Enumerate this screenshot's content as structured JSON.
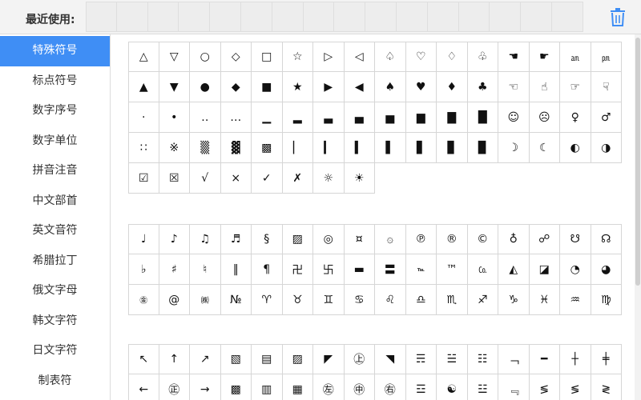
{
  "topbar": {
    "recent_label": "最近使用:",
    "recent_slot_count": 16
  },
  "sidebar": {
    "items": [
      {
        "label": "特殊符号",
        "active": true
      },
      {
        "label": "标点符号",
        "active": false
      },
      {
        "label": "数字序号",
        "active": false
      },
      {
        "label": "数字单位",
        "active": false
      },
      {
        "label": "拼音注音",
        "active": false
      },
      {
        "label": "中文部首",
        "active": false
      },
      {
        "label": "英文音符",
        "active": false
      },
      {
        "label": "希腊拉丁",
        "active": false
      },
      {
        "label": "俄文字母",
        "active": false
      },
      {
        "label": "韩文字符",
        "active": false
      },
      {
        "label": "日文字符",
        "active": false
      },
      {
        "label": "制表符",
        "active": false
      }
    ]
  },
  "groups": [
    {
      "rows": [
        [
          "△",
          "▽",
          "○",
          "◇",
          "□",
          "☆",
          "▷",
          "◁",
          "♤",
          "♡",
          "♢",
          "♧",
          "☚",
          "☛",
          "㏂",
          "㏘"
        ],
        [
          "▲",
          "▼",
          "●",
          "◆",
          "■",
          "★",
          "▶",
          "◀",
          "♠",
          "♥",
          "♦",
          "♣",
          "☜",
          "☝",
          "☞",
          "☟"
        ],
        [
          "·",
          "•",
          "‥",
          "…",
          "▁",
          "▂",
          "▃",
          "▄",
          "▅",
          "▆",
          "▇",
          "█",
          "☺",
          "☹",
          "♀",
          "♂"
        ],
        [
          "∷",
          "※",
          "▒",
          "▓",
          "▩",
          "▏",
          "▎",
          "▍",
          "▌",
          "▋",
          "▊",
          "▉",
          "☽",
          "☾",
          "◐",
          "◑"
        ],
        [
          "☑",
          "☒",
          "√",
          "×",
          "✓",
          "✗",
          "☼",
          "☀"
        ]
      ]
    },
    {
      "rows": [
        [
          "♩",
          "♪",
          "♫",
          "♬",
          "§",
          "▨",
          "◎",
          "¤",
          "۞",
          "℗",
          "®",
          "©",
          "♁",
          "☍",
          "☋",
          "☊"
        ],
        [
          "♭",
          "♯",
          "♮",
          "‖",
          "¶",
          "卍",
          "卐",
          "▬",
          "〓",
          "℡",
          "™",
          "㏇",
          "◭",
          "◪",
          "◔",
          "◕"
        ],
        [
          "㊎",
          "@",
          "㈱",
          "№",
          "♈",
          "♉",
          "♊",
          "♋",
          "♌",
          "♎",
          "♏",
          "♐",
          "♑",
          "♓",
          "♒",
          "♍"
        ]
      ]
    },
    {
      "rows": [
        [
          "↖",
          "↑",
          "↗",
          "▧",
          "▤",
          "▨",
          "◤",
          "㊤",
          "◥",
          "☴",
          "☱",
          "☷",
          "﹁",
          "━",
          "┼",
          "╪"
        ],
        [
          "←",
          "㊣",
          "→",
          "▩",
          "▥",
          "▦",
          "㊧",
          "㊥",
          "㊨",
          "☲",
          "☯",
          "☳",
          "﹃",
          "≶",
          "≶",
          "≷"
        ]
      ]
    }
  ]
}
